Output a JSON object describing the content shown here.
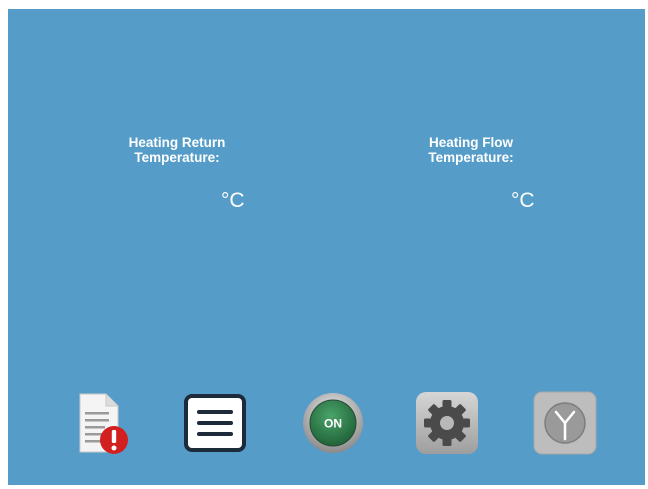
{
  "readings": {
    "heating_return": {
      "label_line1": "Heating Return",
      "label_line2": "Temperature:",
      "value": "",
      "unit": "°C"
    },
    "heating_flow": {
      "label_line1": "Heating Flow",
      "label_line2": "Temperature:",
      "value": "",
      "unit": "°C"
    }
  },
  "toolbar": {
    "events_icon": "document-alert-icon",
    "menu_icon": "menu-list-icon",
    "power_label": "ON",
    "power_icon": "power-on-icon",
    "settings_icon": "gear-icon",
    "time_icon": "clock-icon"
  },
  "colors": {
    "background": "#559dc8",
    "text": "#ffffff",
    "power_green": "#2e7d4a",
    "alert_red": "#d21f1f"
  }
}
